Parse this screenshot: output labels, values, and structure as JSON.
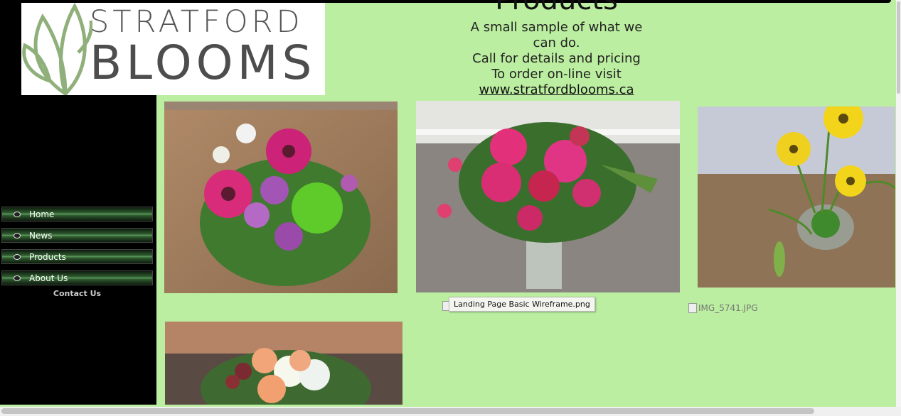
{
  "logo": {
    "line1": "STRATFORD",
    "line2": "BLOOMS"
  },
  "nav": {
    "items": [
      {
        "label": "Home"
      },
      {
        "label": "News"
      },
      {
        "label": "Products"
      },
      {
        "label": "About Us"
      }
    ],
    "contact_label": "Contact Us"
  },
  "header": {
    "title": "Products",
    "lines": [
      "A small sample of what we",
      "can do.",
      "Call for details and pricing",
      "To order on-line visit"
    ],
    "link": "www.stratfordblooms.ca"
  },
  "tooltip": "Landing Page Basic Wireframe.png",
  "broken_image_alt": "IMG_5741.JPG",
  "colors": {
    "page_bg": "#bbeea0",
    "sidebar_bg": "#000000",
    "nav_green": "#3a6e3a"
  }
}
